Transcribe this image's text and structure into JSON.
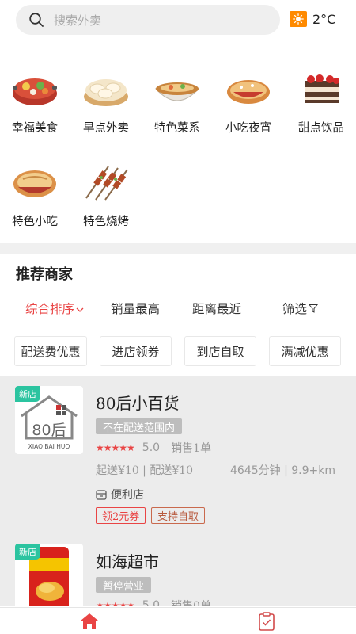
{
  "search": {
    "placeholder": "搜索外卖"
  },
  "weather": {
    "temperature": "2°C",
    "icon": "sun-icon",
    "icon_color": "#ff8a00"
  },
  "categories": [
    {
      "label": "幸福美食",
      "icon": "hotpot-icon"
    },
    {
      "label": "早点外卖",
      "icon": "steamed-bun-icon"
    },
    {
      "label": "特色菜系",
      "icon": "noodle-bowl-icon"
    },
    {
      "label": "小吃夜宵",
      "icon": "flatbread-sandwich-icon"
    },
    {
      "label": "甜点饮品",
      "icon": "cake-icon"
    },
    {
      "label": "特色小吃",
      "icon": "roujiamo-icon"
    },
    {
      "label": "特色烧烤",
      "icon": "skewers-icon"
    }
  ],
  "recommend": {
    "title": "推荐商家",
    "sorts": [
      {
        "label": "综合排序",
        "active": true
      },
      {
        "label": "销量最高",
        "active": false
      },
      {
        "label": "距离最近",
        "active": false
      },
      {
        "label": "筛选",
        "active": false
      }
    ],
    "tags": [
      "配送费优惠",
      "进店领券",
      "到店自取",
      "满减优惠"
    ]
  },
  "stores": [
    {
      "badge": "新店",
      "name": "80后小百货",
      "logo_text": "80后",
      "logo_subtext": "XIAO BAI HUO",
      "status": "不在配送范围内",
      "score": "5.0",
      "sales": "销售1单",
      "delivery": "起送¥10 | 配送¥10",
      "distance": "4645分钟 | 9.9+km",
      "type": "便利店",
      "coupons": [
        "领2元券",
        "支持自取"
      ]
    },
    {
      "badge": "新店",
      "name": "如海超市",
      "status": "暂停营业",
      "score": "5.0",
      "sales": "销售0单"
    }
  ],
  "colors": {
    "accent": "#e94444",
    "badge": "#2bc4a0",
    "status_gray": "#bdbdbd"
  },
  "bottom_nav": [
    {
      "name": "home-icon",
      "active": true
    },
    {
      "name": "orders-icon",
      "active": false
    }
  ]
}
